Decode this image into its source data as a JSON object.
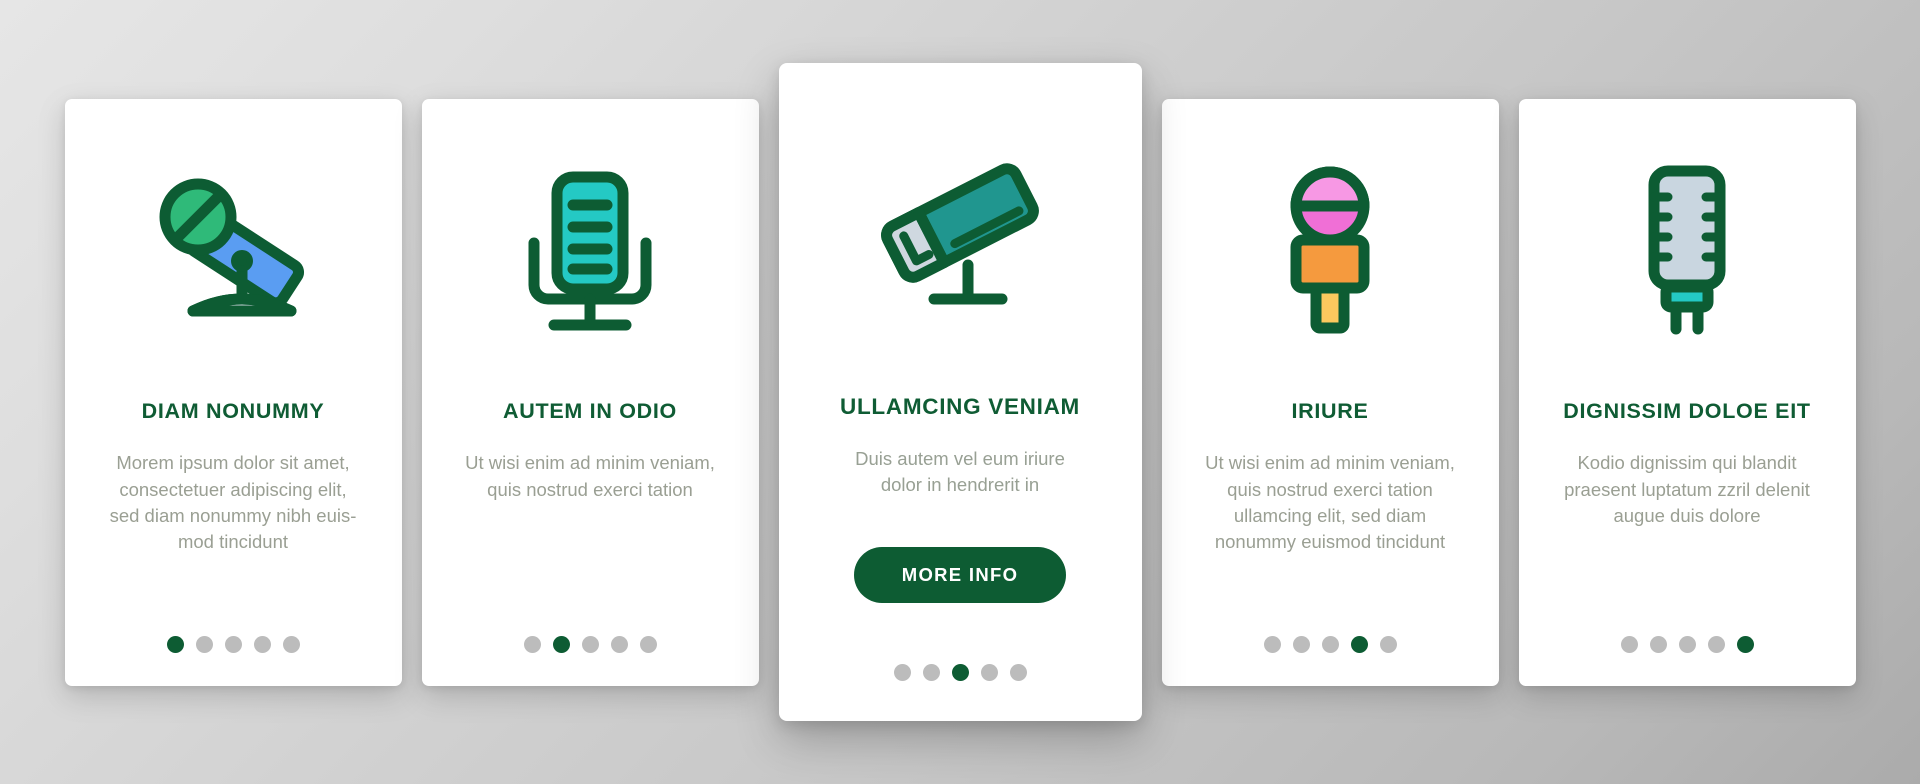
{
  "page": {
    "background_gradient_from": "#e6e6e6",
    "background_gradient_to": "#ababab",
    "accent_green": "#0d5c33",
    "body_text_color": "#9a9f93",
    "dot_inactive_color": "#bcbcbc"
  },
  "cards": [
    {
      "icon": "microphone-stand-tilted-icon",
      "title": "DIAM NONUMMY",
      "body": "Morem ipsum dolor sit amet, consectetuer adipiscing elit, sed diam nonummy nibh euis-mod tincidunt",
      "dots_total": 5,
      "dots_active_index": 1,
      "featured": false
    },
    {
      "icon": "studio-microphone-icon",
      "title": "AUTEM IN ODIO",
      "body": "Ut wisi enim ad minim veniam, quis nostrud exerci tation",
      "dots_total": 5,
      "dots_active_index": 2,
      "featured": false
    },
    {
      "icon": "desk-microphone-tilted-icon",
      "title": "ULLAMCING VENIAM",
      "body": "Duis autem vel eum iriure dolor in hendrerit in",
      "button_label": "MORE INFO",
      "dots_total": 5,
      "dots_active_index": 3,
      "featured": true
    },
    {
      "icon": "reporter-microphone-icon",
      "title": "IRIURE",
      "body": "Ut wisi enim ad minim veniam, quis nostrud exerci tation ullamcing elit, sed diam nonummy euismod tincidunt",
      "dots_total": 5,
      "dots_active_index": 4,
      "featured": false
    },
    {
      "icon": "vintage-microphone-icon",
      "title": "DIGNISSIM DOLOE EIT",
      "body": "Kodio dignissim qui blandit praesent luptatum zzril delenit augue duis dolore",
      "dots_total": 5,
      "dots_active_index": 5,
      "featured": false
    }
  ]
}
